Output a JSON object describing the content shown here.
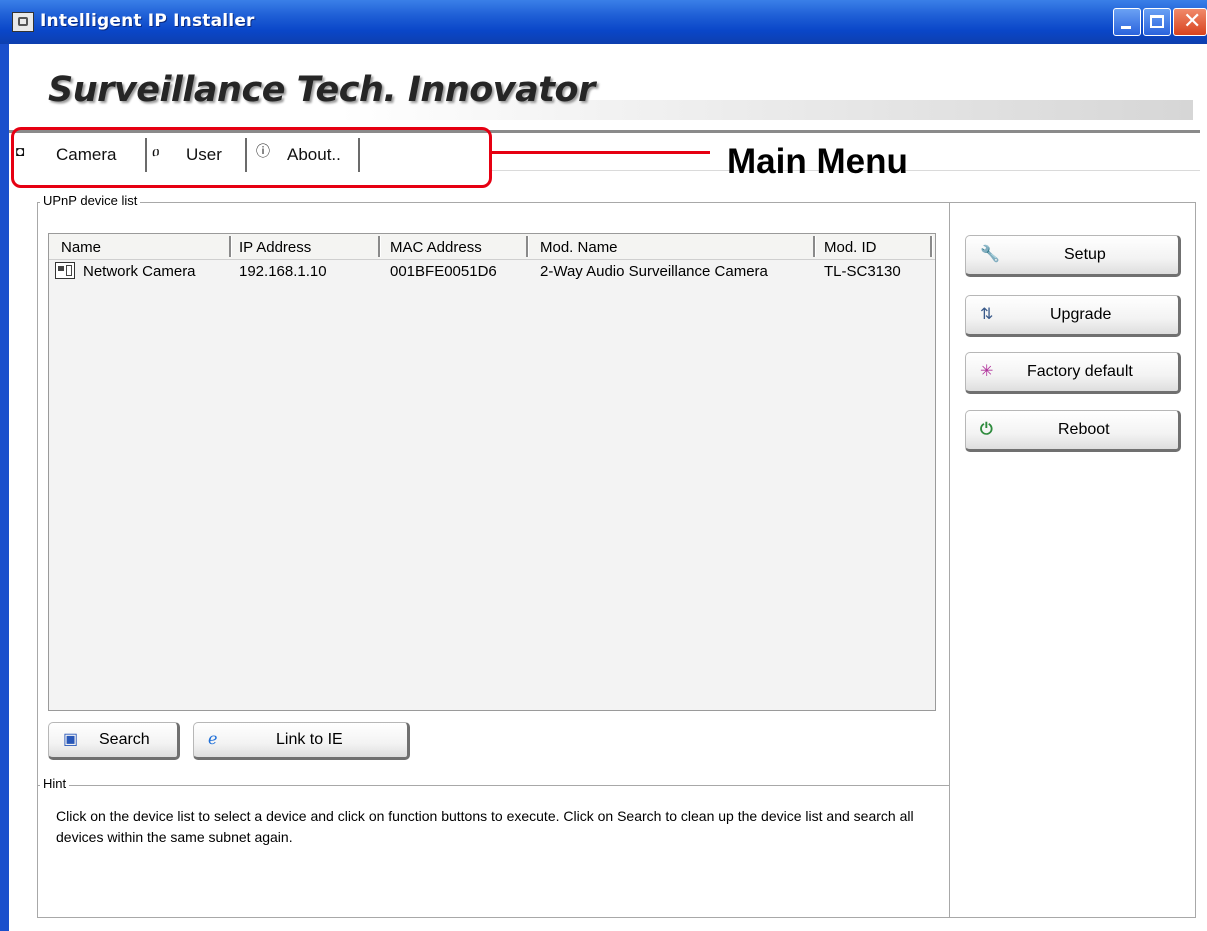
{
  "window": {
    "title": "Intelligent IP Installer"
  },
  "banner": {
    "brand": "Surveillance Tech. Innovator"
  },
  "tabs": [
    {
      "label": "Camera",
      "icon": "camera-icon"
    },
    {
      "label": "User",
      "icon": "user-icon"
    },
    {
      "label": "About..",
      "icon": "info-icon"
    }
  ],
  "annotation": {
    "label": "Main Menu",
    "color": "#e60012"
  },
  "device_list": {
    "group_label": "UPnP device list",
    "columns": [
      "Name",
      "IP Address",
      "MAC Address",
      "Mod. Name",
      "Mod. ID"
    ],
    "rows": [
      {
        "name": "Network Camera",
        "ip": "192.168.1.10",
        "mac": "001BFE0051D6",
        "mod_name": "2-Way Audio Surveillance Camera",
        "mod_id": "TL-SC3130"
      }
    ]
  },
  "actions": {
    "setup": "Setup",
    "upgrade": "Upgrade",
    "factory_default": "Factory default",
    "reboot": "Reboot"
  },
  "bottom_buttons": {
    "search": "Search",
    "link_ie": "Link to IE"
  },
  "hint": {
    "label": "Hint",
    "text": "Click on the device list to select a device and click on function buttons to execute. Click on Search to clean up the device list and search all devices  within the same subnet again."
  },
  "colors": {
    "titlebar": "#0a46c8",
    "callout": "#e60012",
    "reboot_icon": "#2e8b3d",
    "factory_icon": "#b0309a"
  }
}
